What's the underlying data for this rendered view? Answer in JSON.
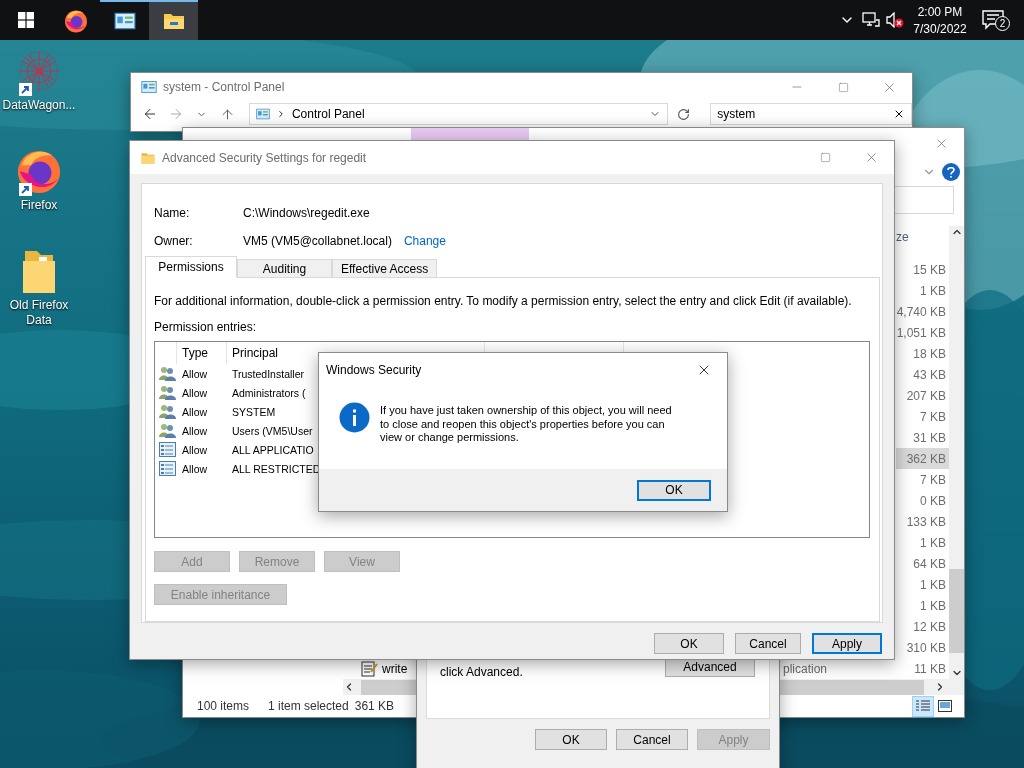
{
  "taskbar": {
    "apps": [
      {
        "kind": "firefox",
        "running": false,
        "active": false
      },
      {
        "kind": "control-panel",
        "running": true,
        "active": false
      },
      {
        "kind": "explorer",
        "running": true,
        "active": true
      }
    ],
    "volume_muted": true,
    "clock": {
      "time": "2:00 PM",
      "date": "7/30/2022"
    },
    "notifications": "2"
  },
  "desktop_icons": [
    {
      "kind": "network",
      "label": "DataWagon...",
      "shortcut": true
    },
    {
      "kind": "firefox",
      "label": "Firefox",
      "shortcut": true
    },
    {
      "kind": "folder",
      "label": "Old Firefox Data",
      "shortcut": false
    }
  ],
  "control_panel": {
    "title": "system - Control Panel",
    "address": "Control Panel",
    "search": "system"
  },
  "explorer": {
    "size_header": "ze",
    "files": [
      {
        "size": "15 KB",
        "selected": false
      },
      {
        "size": "1 KB",
        "selected": false
      },
      {
        "size": "4,740 KB",
        "selected": false
      },
      {
        "size": "1,051 KB",
        "selected": false
      },
      {
        "size": "18 KB",
        "selected": false
      },
      {
        "size": "43 KB",
        "selected": false
      },
      {
        "size": "207 KB",
        "selected": false
      },
      {
        "size": "7 KB",
        "selected": false
      },
      {
        "size": "31 KB",
        "selected": false
      },
      {
        "size": "362 KB",
        "selected": true
      },
      {
        "size": "7 KB",
        "selected": false
      },
      {
        "size": "0 KB",
        "selected": false
      },
      {
        "size": "133 KB",
        "selected": false
      },
      {
        "size": "1 KB",
        "selected": false
      },
      {
        "size": "64 KB",
        "selected": false
      },
      {
        "size": "1 KB",
        "selected": false
      },
      {
        "size": "1 KB",
        "selected": false
      },
      {
        "size": "12 KB",
        "selected": false
      },
      {
        "size": "310 KB",
        "selected": false
      },
      {
        "name": "write",
        "type": "plication",
        "size": "11 KB",
        "selected": false
      }
    ],
    "status": {
      "count": "100 items",
      "selection": "1 item selected",
      "size": "361 KB"
    }
  },
  "properties_dialog": {
    "note": "click Advanced.",
    "advanced_button": "Advanced",
    "buttons": [
      {
        "label": "OK",
        "disabled": false
      },
      {
        "label": "Cancel",
        "disabled": false
      },
      {
        "label": "Apply",
        "disabled": true
      }
    ]
  },
  "security_settings": {
    "title": "Advanced Security Settings for regedit",
    "name_label": "Name:",
    "name": "C:\\Windows\\regedit.exe",
    "owner_label": "Owner:",
    "owner": "VM5 (VM5@collabnet.local)",
    "change_link": "Change",
    "tabs": [
      {
        "label": "Permissions",
        "selected": true
      },
      {
        "label": "Auditing",
        "selected": false
      },
      {
        "label": "Effective Access",
        "selected": false
      }
    ],
    "info": "For additional information, double-click a permission entry. To modify a permission entry, select the entry and click Edit (if available).",
    "entries_label": "Permission entries:",
    "columns": [
      "Type",
      "Principal"
    ],
    "entries": [
      {
        "kind": "group",
        "type": "Allow",
        "principal": "TrustedInstaller"
      },
      {
        "kind": "group",
        "type": "Allow",
        "principal": "Administrators ("
      },
      {
        "kind": "group",
        "type": "Allow",
        "principal": "SYSTEM"
      },
      {
        "kind": "group",
        "type": "Allow",
        "principal": "Users (VM5\\User"
      },
      {
        "kind": "package",
        "type": "Allow",
        "principal": "ALL APPLICATIO"
      },
      {
        "kind": "package",
        "type": "Allow",
        "principal": "ALL RESTRICTED"
      }
    ],
    "actions": [
      {
        "label": "Add",
        "disabled": true
      },
      {
        "label": "Remove",
        "disabled": true
      },
      {
        "label": "View",
        "disabled": true
      }
    ],
    "inheritance_button": {
      "label": "Enable inheritance",
      "disabled": true
    },
    "buttons": [
      {
        "label": "OK",
        "default": false
      },
      {
        "label": "Cancel",
        "default": false
      },
      {
        "label": "Apply",
        "default": true
      }
    ]
  },
  "security_dialog": {
    "title": "Windows Security",
    "message": "If you have just taken ownership of this object, you will need to close and reopen this object's properties before you can view or change permissions.",
    "button": "OK"
  }
}
